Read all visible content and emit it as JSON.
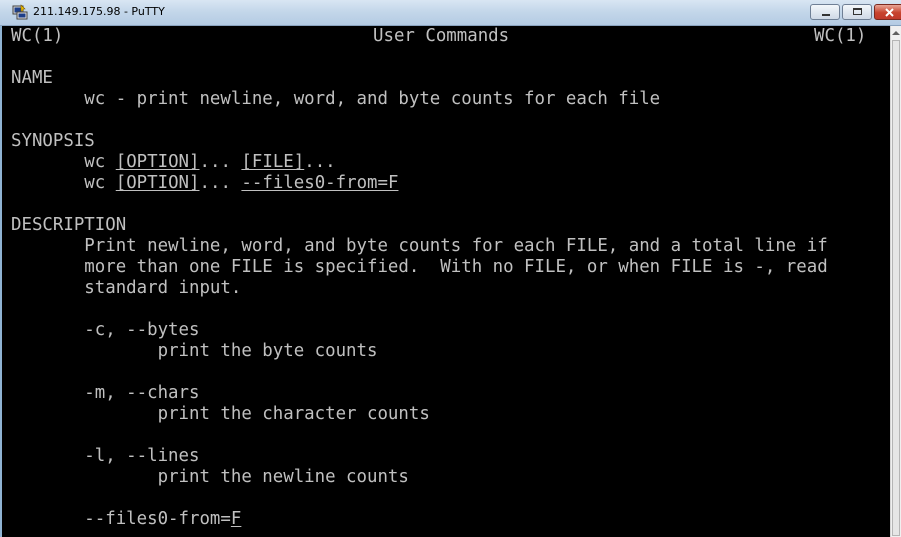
{
  "window": {
    "title": "211.149.175.98 - PuTTY",
    "icon": "putty-icon",
    "controls": {
      "minimize": "minimize-icon",
      "maximize": "maximize-icon",
      "close": "close-icon"
    }
  },
  "terminal": {
    "header": {
      "left": "WC(1)",
      "center": "User Commands",
      "right": "WC(1)"
    },
    "name_heading": "NAME",
    "name_desc": "wc - print newline, word, and byte counts for each file",
    "synopsis_heading": "SYNOPSIS",
    "synopsis": [
      {
        "cmd": "wc",
        "opt": "[OPTION]",
        "sep": "...",
        "arg": "[FILE]",
        "tail": "..."
      },
      {
        "cmd": "wc",
        "opt": "[OPTION]",
        "sep": "...",
        "arg": "--files0-from=F",
        "tail": ""
      }
    ],
    "description_heading": "DESCRIPTION",
    "description": [
      "Print newline, word, and byte counts for each FILE, and a total line if",
      "more than one FILE is specified.  With no FILE, or when FILE is -, read",
      "standard input."
    ],
    "options": [
      {
        "flag": "-c, --bytes",
        "desc": "print the byte counts"
      },
      {
        "flag": "-m, --chars",
        "desc": "print the character counts"
      },
      {
        "flag": "-l, --lines",
        "desc": "print the newline counts"
      }
    ],
    "files0": {
      "flag": "--files0-from=",
      "arg": "F"
    }
  },
  "colors": {
    "terminal_bg": "#000000",
    "terminal_fg": "#c0c0c0",
    "titlebar": "#c4d7ea",
    "close_button": "#c7432e"
  }
}
